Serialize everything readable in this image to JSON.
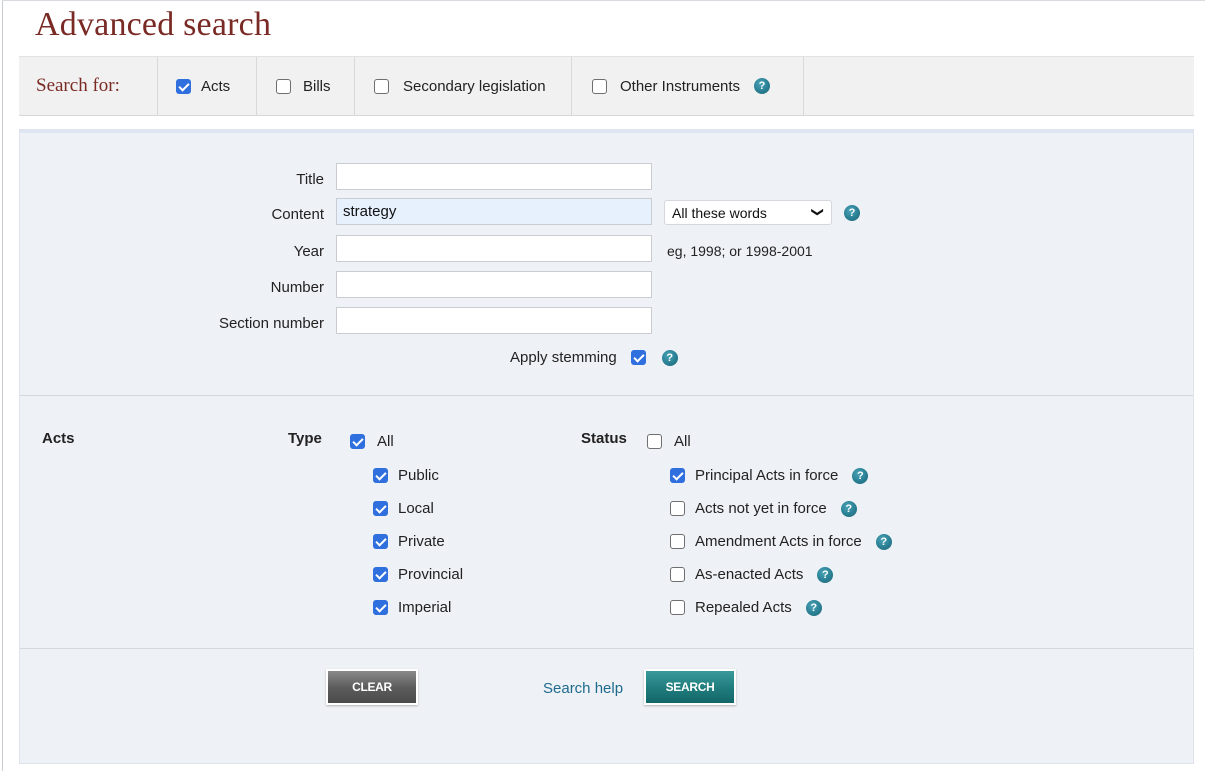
{
  "page": {
    "title": "Advanced search"
  },
  "search_for": {
    "label": "Search for:",
    "options": [
      {
        "label": "Acts",
        "checked": true
      },
      {
        "label": "Bills",
        "checked": false
      },
      {
        "label": "Secondary legislation",
        "checked": false
      },
      {
        "label": "Other Instruments",
        "checked": false,
        "help": true
      }
    ]
  },
  "form": {
    "title_label": "Title",
    "title_value": "",
    "content_label": "Content",
    "content_value": "strategy",
    "content_mode": "All these words",
    "year_label": "Year",
    "year_value": "",
    "year_hint": "eg, 1998; or 1998-2001",
    "number_label": "Number",
    "number_value": "",
    "section_label": "Section number",
    "section_value": "",
    "stemming_label": "Apply stemming",
    "stemming_checked": true
  },
  "acts": {
    "heading": "Acts",
    "type_label": "Type",
    "type_all": {
      "label": "All",
      "checked": true
    },
    "types": [
      {
        "label": "Public",
        "checked": true
      },
      {
        "label": "Local",
        "checked": true
      },
      {
        "label": "Private",
        "checked": true
      },
      {
        "label": "Provincial",
        "checked": true
      },
      {
        "label": "Imperial",
        "checked": true
      }
    ],
    "status_label": "Status",
    "status_all": {
      "label": "All",
      "checked": false
    },
    "statuses": [
      {
        "label": "Principal Acts in force",
        "checked": true
      },
      {
        "label": "Acts not yet in force",
        "checked": false
      },
      {
        "label": "Amendment Acts in force",
        "checked": false
      },
      {
        "label": "As-enacted Acts",
        "checked": false
      },
      {
        "label": "Repealed Acts",
        "checked": false
      }
    ]
  },
  "actions": {
    "clear": "CLEAR",
    "help": "Search help",
    "search": "SEARCH"
  },
  "icons": {
    "help": "?",
    "chevron": "❯"
  },
  "colors": {
    "title": "#7a2a24",
    "checkbox": "#2f6fde",
    "search_button": "#1f7b7c",
    "link": "#1e6b8e"
  }
}
